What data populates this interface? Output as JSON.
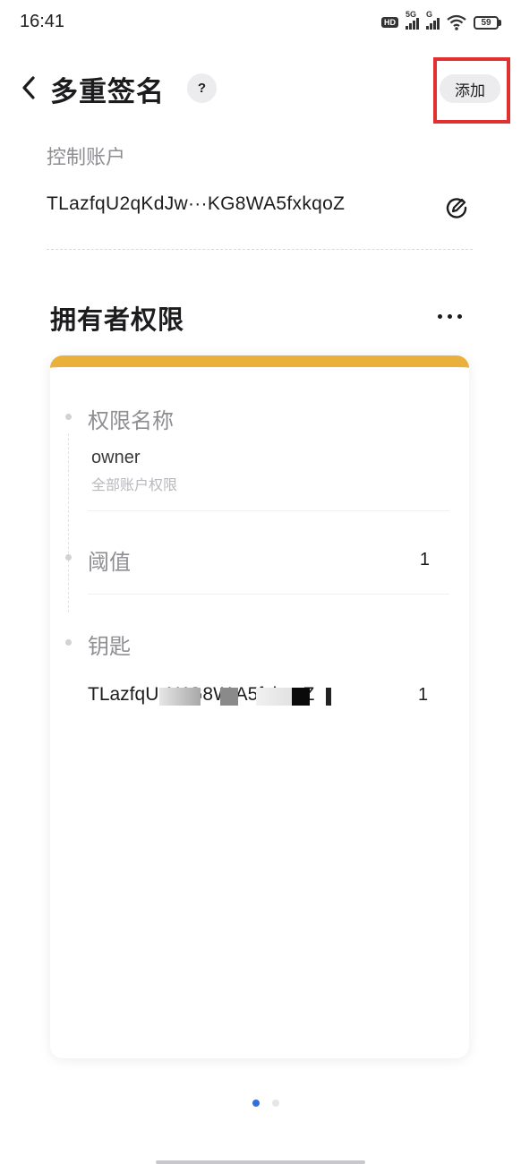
{
  "status_bar": {
    "time": "16:41",
    "icons": [
      "hd-icon",
      "signal-5g-icon",
      "signal-g-icon",
      "wifi-icon",
      "battery-icon"
    ],
    "network_5g": "5G",
    "network_g": "G",
    "battery_level": "59"
  },
  "header": {
    "title": "多重签名",
    "help_label": "?",
    "add_label": "添加",
    "back_icon": "chevron-left-icon"
  },
  "control_account": {
    "label": "控制账户",
    "address": "TLazfqU2qKdJw···KG8WA5fxkqoZ",
    "edit_icon": "edit-icon"
  },
  "owner_permission": {
    "title": "拥有者权限",
    "more_icon": "more-horizontal-icon",
    "accent_color": "#e9b13b",
    "fields": {
      "name_label": "权限名称",
      "name_value": "owner",
      "name_sub": "全部账户权限",
      "threshold_label": "阈值",
      "threshold_value": "1",
      "keys_label": "钥匙"
    },
    "keys": [
      {
        "address": "TLazfqU          AKG8W A5fxkqoZ",
        "weight": "1"
      }
    ]
  },
  "pager": {
    "total": 2,
    "active": 0,
    "active_color": "#2f6fe0",
    "inactive_color": "#e6e6ea"
  },
  "colors": {
    "highlight_box": "#e03030"
  }
}
